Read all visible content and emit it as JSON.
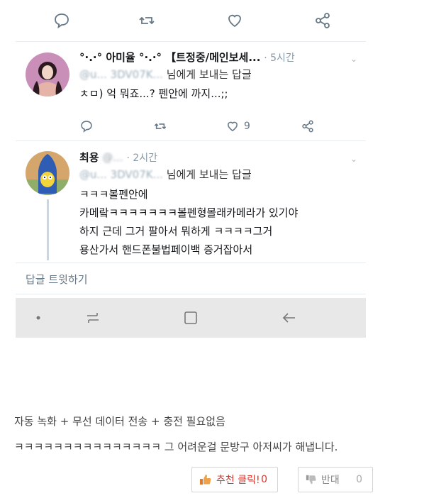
{
  "tweet1": {
    "name": "°·.·° 아미율 °·.·° 【트정중/메인보세...",
    "time": "· 5시간",
    "reply_handle": "@u... 3DV07K...",
    "reply_suffix": "님에게 보내는 답글",
    "text": "ㅊㅁ) 억 뭐죠...? 펜안에 까지...;;",
    "likes": "9"
  },
  "tweet2": {
    "name": "최용",
    "handle": "@...",
    "time": "· 2시간",
    "reply_handle": "@u... 3DV07K...",
    "reply_suffix": "님에게 보내는 답글",
    "lines": [
      "ㅋㅋㅋ볼펜안에",
      "카메랔ㅋㅋㅋㅋㅋㅋㅋ볼펜형몰래카메라가 있기야",
      "하지 근데 그거 팔아서 뭐하게 ㅋㅋㅋㅋ그거",
      "용산가서 핸드폰불법페이백 증거잡아서"
    ]
  },
  "reply_bar": {
    "placeholder": "답글 트윗하기"
  },
  "caption": {
    "line1": "자동 녹화 + 무선 데이터 전송 + 충전 필요없음",
    "line2": "ㅋㅋㅋㅋㅋㅋㅋㅋㅋㅋㅋㅋㅋㅋㅋ 그 어려운걸 문방구 아저씨가 해냅니다."
  },
  "votes": {
    "up_label": "추천 클릭!",
    "up_count": "0",
    "down_label": "반대",
    "down_count": "0"
  },
  "colors": {
    "accent_red": "#d9362b",
    "icon_gray": "#657786",
    "nav_bg": "#e8e8e8"
  }
}
